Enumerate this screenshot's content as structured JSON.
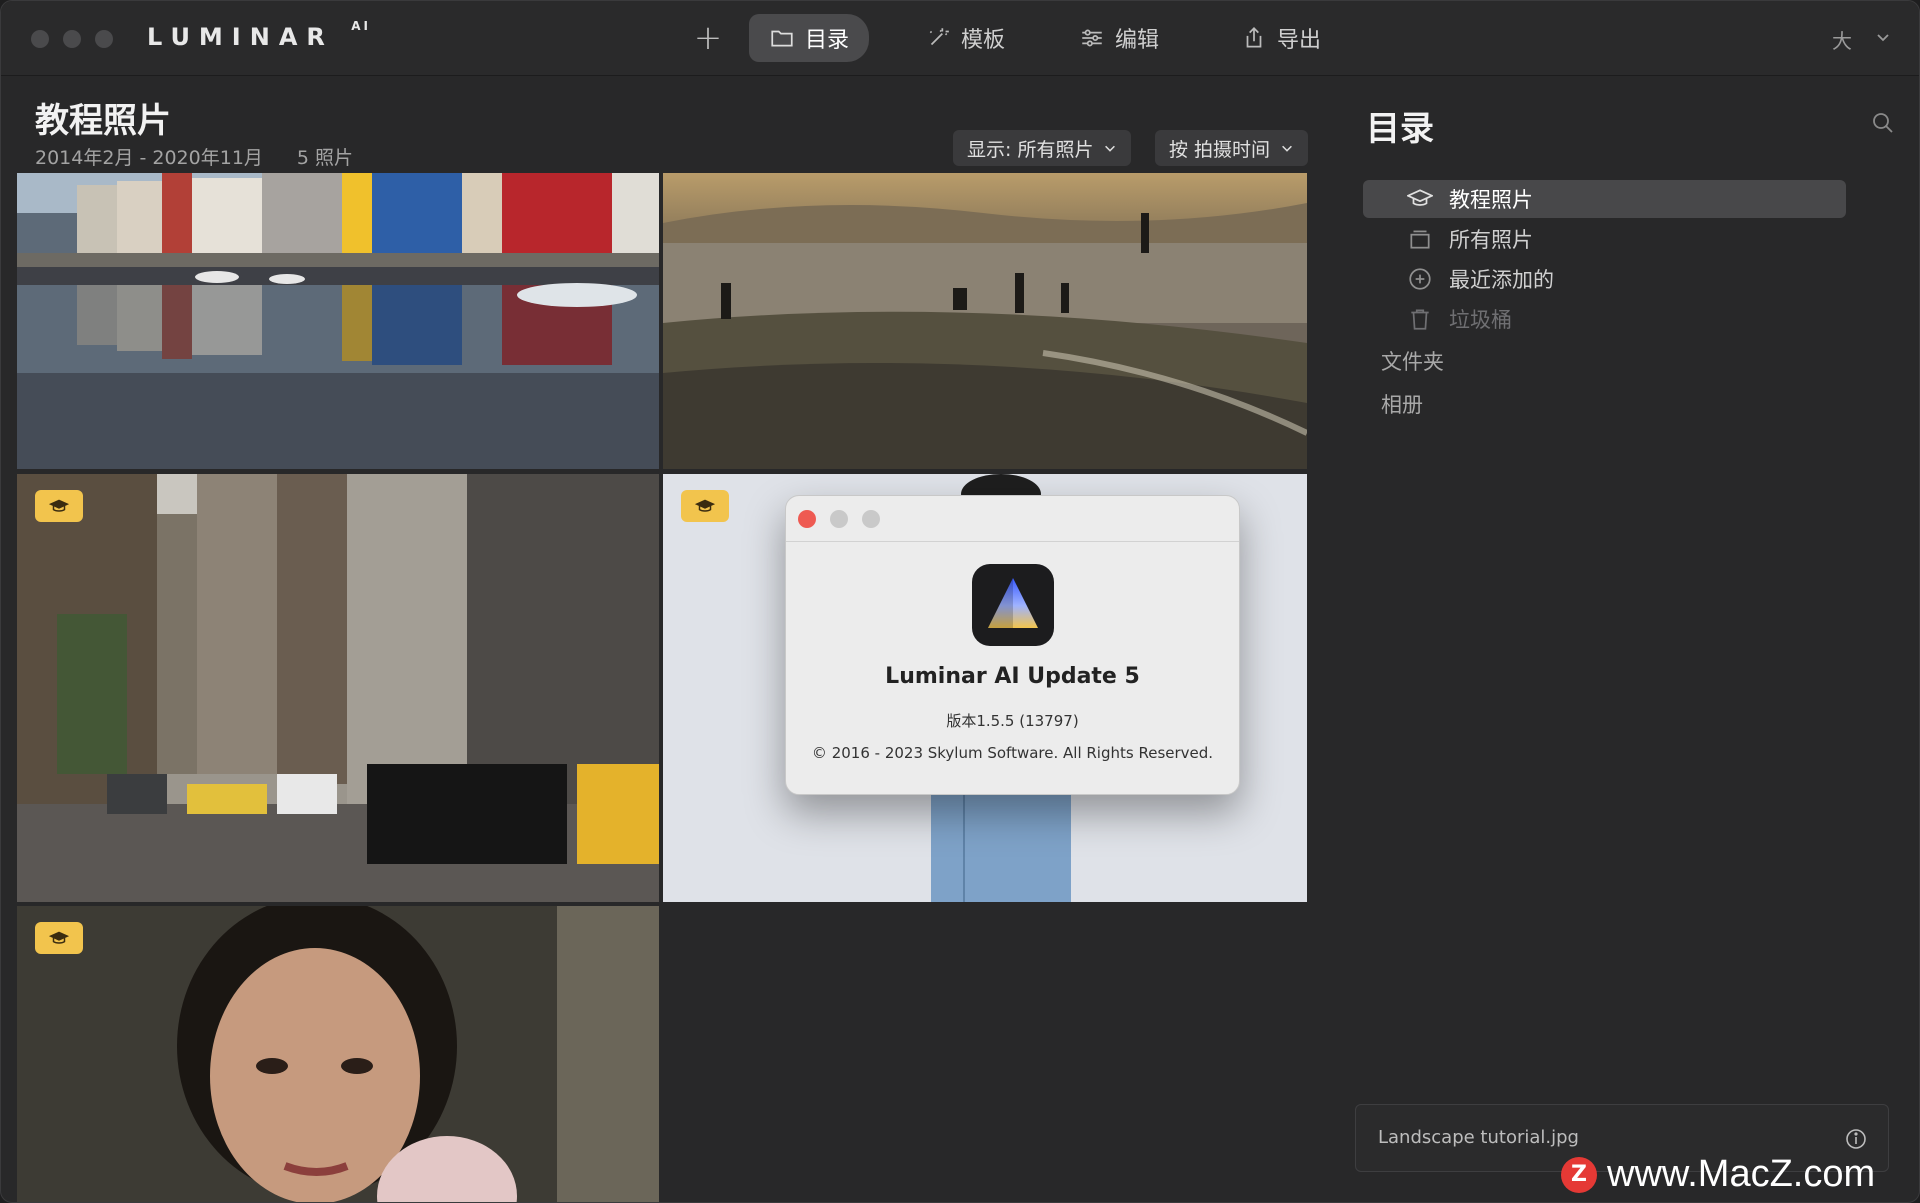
{
  "app": {
    "logo": "LUMINAR",
    "logo_suffix": "AI"
  },
  "toolbar": {
    "add_label": "+",
    "tabs": [
      {
        "label": "目录",
        "icon": "folder-icon",
        "active": true
      },
      {
        "label": "模板",
        "icon": "magic-wand-icon",
        "active": false
      },
      {
        "label": "编辑",
        "icon": "sliders-icon",
        "active": false
      },
      {
        "label": "导出",
        "icon": "share-icon",
        "active": false
      }
    ],
    "size_label": "大"
  },
  "album": {
    "title": "教程照片",
    "date_range": "2014年2月 - 2020年11月",
    "count": "5 照片",
    "filter_label": "显示:  所有照片",
    "sort_label": "按 拍摄时间"
  },
  "photos": [
    {
      "name": "harbor-reflection",
      "badge": false,
      "selected": true
    },
    {
      "name": "beach-sunset",
      "badge": false,
      "selected": false
    },
    {
      "name": "city-street",
      "badge": true,
      "selected": false
    },
    {
      "name": "portrait-jeans",
      "badge": true,
      "selected": false
    },
    {
      "name": "portrait-woman",
      "badge": true,
      "selected": false
    }
  ],
  "about_dialog": {
    "app_name": "Luminar AI Update 5",
    "version": "版本1.5.5 (13797)",
    "copyright": "© 2016 - 2023 Skylum Software. All Rights Reserved."
  },
  "sidebar": {
    "title": "目录",
    "items": [
      {
        "label": "教程照片",
        "icon": "graduation-cap-icon",
        "active": true
      },
      {
        "label": "所有照片",
        "icon": "photo-stack-icon",
        "active": false
      },
      {
        "label": "最近添加的",
        "icon": "plus-circle-icon",
        "active": false
      },
      {
        "label": "垃圾桶",
        "icon": "trash-icon",
        "active": false
      }
    ],
    "folders_label": "文件夹",
    "albums_label": "相册",
    "selected_file": "Landscape tutorial.jpg"
  },
  "watermark": {
    "logo": "Z",
    "text": "www.MacZ.com"
  },
  "colors": {
    "selection": "#6ec3ff",
    "badge": "#f2c44d",
    "close_red": "#ee5a52"
  }
}
